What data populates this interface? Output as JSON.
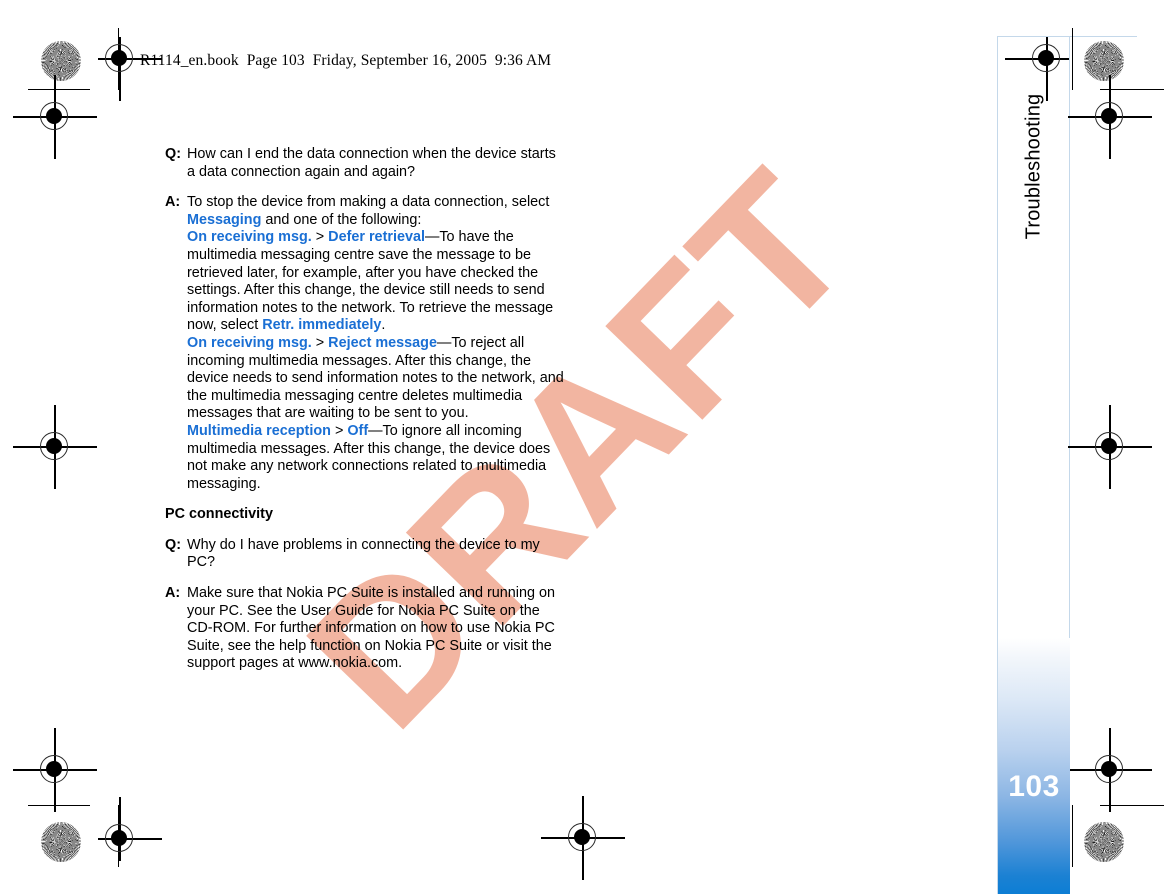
{
  "book_header": "R1114_en.book  Page 103  Friday, September 16, 2005  9:36 AM",
  "watermark": {
    "text": "DRAFT",
    "color": "#f2b5a1"
  },
  "sidebar": {
    "chapter_title": "Troubleshooting",
    "page_number": "103",
    "gradient_top_color": "#ffffff",
    "gradient_bottom_color": "#0d7ed4",
    "page_number_color": "#ffffff"
  },
  "colors": {
    "link_blue": "#1a6fd4",
    "body_text": "#000000",
    "page_edge": "#c4d8ea"
  },
  "content": {
    "q1": {
      "label": "Q:",
      "text": "How can I end the data connection when the device starts a data connection again and again?"
    },
    "a1": {
      "label": "A:",
      "intro_before_link": "To stop the device from making a data connection, select ",
      "link_messaging": "Messaging",
      "intro_after_link": " and one of the following:",
      "bullet1": {
        "link_a": "On receiving msg.",
        "separator": ">",
        "link_b": "Defer retrieval",
        "text": "—To have the multimedia messaging centre save the message to be retrieved later, for example, after you have checked the settings. After this change, the device still needs to send information notes to the network. To retrieve the message now, select ",
        "link_c": "Retr. immediately",
        "text_end": "."
      },
      "bullet2": {
        "link_a": "On receiving msg.",
        "separator": ">",
        "link_b": "Reject message",
        "text": "—To reject all incoming multimedia messages. After this change, the device needs to send information notes to the network, and the multimedia messaging centre deletes multimedia messages that are waiting to be sent to you."
      },
      "bullet3": {
        "link_a": "Multimedia reception",
        "separator": ">",
        "link_b": "Off",
        "text": "—To ignore all incoming multimedia messages. After this change, the device does not make any network connections related to multimedia messaging."
      }
    },
    "section_heading": "PC connectivity",
    "q2": {
      "label": "Q:",
      "text": "Why do I have problems in connecting the device to my PC?"
    },
    "a2": {
      "label": "A:",
      "text": "Make sure that Nokia PC Suite is installed and running on your PC. See the User Guide for Nokia PC Suite on the CD-ROM. For further information on how to use Nokia PC Suite, see the help function on Nokia PC Suite or visit the support pages at www.nokia.com."
    }
  }
}
